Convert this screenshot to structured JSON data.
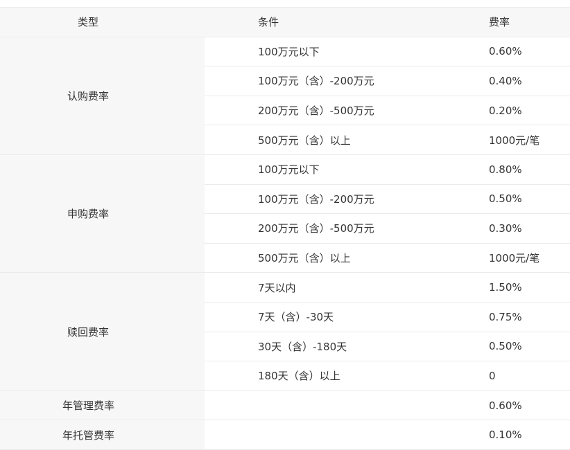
{
  "table": {
    "headers": {
      "type": "类型",
      "condition": "条件",
      "rate": "费率"
    },
    "groups": [
      {
        "type": "认购费率",
        "rows": [
          {
            "condition": "100万元以下",
            "rate": "0.60%"
          },
          {
            "condition": "100万元（含）-200万元",
            "rate": "0.40%"
          },
          {
            "condition": "200万元（含）-500万元",
            "rate": "0.20%"
          },
          {
            "condition": "500万元（含）以上",
            "rate": "1000元/笔"
          }
        ]
      },
      {
        "type": "申购费率",
        "rows": [
          {
            "condition": "100万元以下",
            "rate": "0.80%"
          },
          {
            "condition": "100万元（含）-200万元",
            "rate": "0.50%"
          },
          {
            "condition": "200万元（含）-500万元",
            "rate": "0.30%"
          },
          {
            "condition": "500万元（含）以上",
            "rate": "1000元/笔"
          }
        ]
      },
      {
        "type": "赎回费率",
        "rows": [
          {
            "condition": "7天以内",
            "rate": "1.50%"
          },
          {
            "condition": "7天（含）-30天",
            "rate": "0.75%"
          },
          {
            "condition": "30天（含）-180天",
            "rate": "0.50%"
          },
          {
            "condition": "180天（含）以上",
            "rate": "0"
          }
        ]
      },
      {
        "type": "年管理费率",
        "rows": [
          {
            "condition": "",
            "rate": "0.60%"
          }
        ]
      },
      {
        "type": "年托管费率",
        "rows": [
          {
            "condition": "",
            "rate": "0.10%"
          }
        ]
      }
    ]
  }
}
